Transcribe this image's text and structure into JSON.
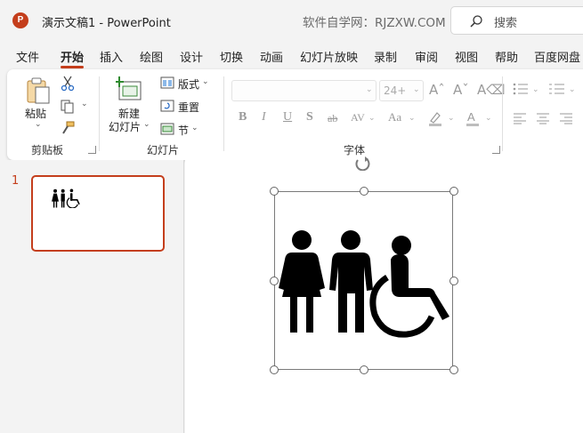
{
  "app": {
    "logo_letter": "P",
    "title": "演示文稿1  -  PowerPoint",
    "watermark": "软件自学网：RJZXW.COM",
    "search_label": "搜索"
  },
  "tabs": [
    {
      "label": "文件",
      "active": false
    },
    {
      "label": "开始",
      "active": true
    },
    {
      "label": "插入",
      "active": false
    },
    {
      "label": "绘图",
      "active": false
    },
    {
      "label": "设计",
      "active": false
    },
    {
      "label": "切换",
      "active": false
    },
    {
      "label": "动画",
      "active": false
    },
    {
      "label": "幻灯片放映",
      "active": false
    },
    {
      "label": "录制",
      "active": false
    },
    {
      "label": "审阅",
      "active": false
    },
    {
      "label": "视图",
      "active": false
    },
    {
      "label": "帮助",
      "active": false
    },
    {
      "label": "百度网盘",
      "active": false
    }
  ],
  "ribbon": {
    "clipboard": {
      "paste_label": "粘贴",
      "group_label": "剪贴板",
      "icons": [
        "paste-icon",
        "cut-icon",
        "copy-icon",
        "format-painter-icon"
      ]
    },
    "slides": {
      "new_slide_label": "新建",
      "new_slide_label2": "幻灯片",
      "layout_label": "版式",
      "reset_label": "重置",
      "section_label": "节",
      "group_label": "幻灯片"
    },
    "font": {
      "font_name": "",
      "font_size": "24+",
      "group_label": "字体",
      "format_buttons": [
        "B",
        "I",
        "U",
        "S",
        "ab",
        "AV",
        "Aa"
      ]
    }
  },
  "slides_pane": {
    "slide_number": "1"
  },
  "colors": {
    "accent": "#c43e1c",
    "chrome": "#f3f3f3"
  }
}
